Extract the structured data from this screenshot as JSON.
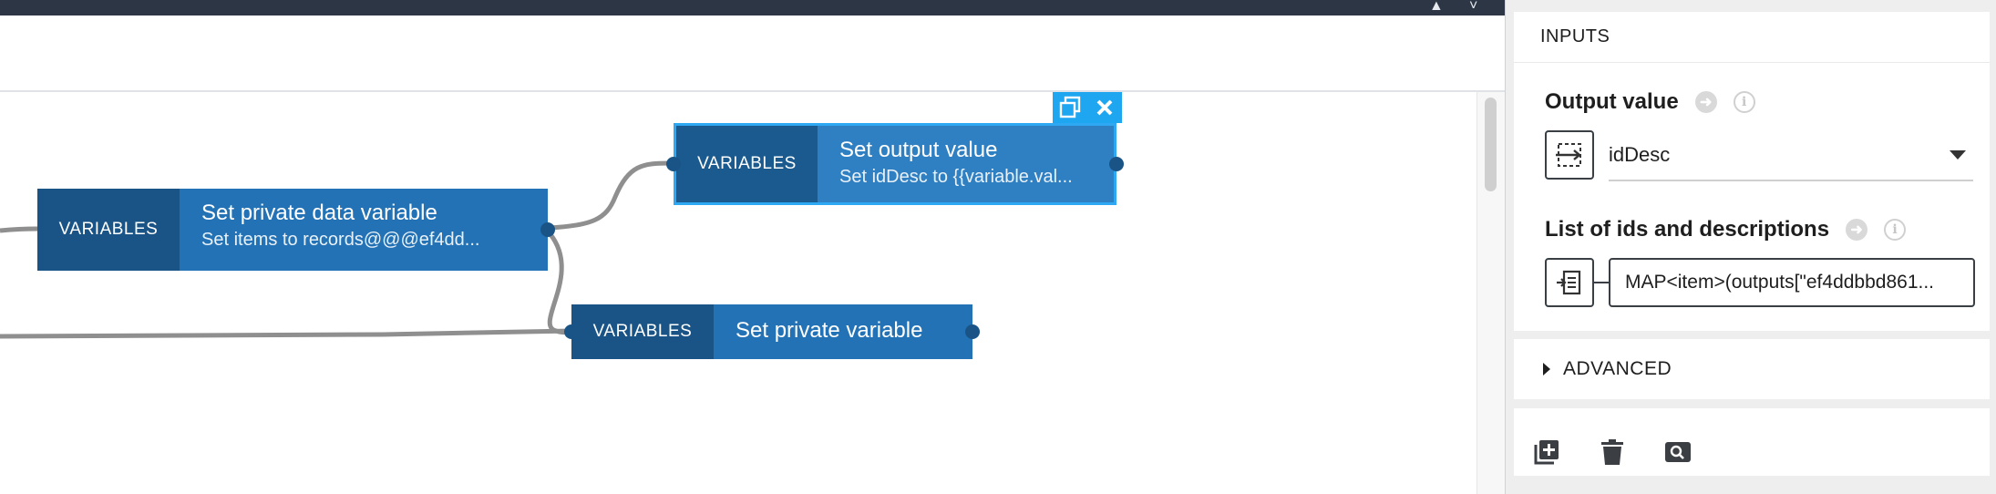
{
  "canvas": {
    "nodes": [
      {
        "category": "VARIABLES",
        "title": "Set private data variable",
        "subtitle": "Set items to records@@@ef4dd..."
      },
      {
        "category": "VARIABLES",
        "title": "Set output value",
        "subtitle": "Set idDesc to {{variable.val..."
      },
      {
        "category": "VARIABLES",
        "title": "Set private variable"
      }
    ]
  },
  "panel": {
    "inputs_header": "INPUTS",
    "output_value": {
      "label": "Output value",
      "selected": "idDesc"
    },
    "list_field": {
      "label": "List of ids and descriptions",
      "value": "MAP<item>(outputs[\"ef4ddbbd861..."
    },
    "advanced_label": "ADVANCED",
    "icons": [
      "copy-icon",
      "close-icon",
      "arrow-right-circle-icon",
      "info-icon",
      "variable-swap-icon",
      "expression-icon",
      "add-icon",
      "trash-icon",
      "search-icon",
      "caret-right-icon"
    ]
  },
  "colors": {
    "node_body": "#2272b5",
    "node_category": "#1a5486",
    "selected_border": "#2ea8f2",
    "topbar": "#2c3644"
  }
}
